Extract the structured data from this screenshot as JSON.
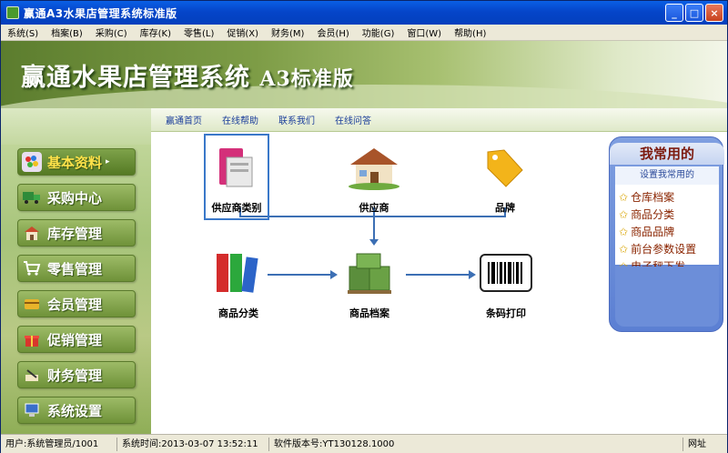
{
  "window": {
    "title": "赢通A3水果店管理系统标准版",
    "btn_min": "_",
    "btn_max": "□",
    "btn_close": "×"
  },
  "menu": [
    "系统(S)",
    "档案(B)",
    "采购(C)",
    "库存(K)",
    "零售(L)",
    "促销(X)",
    "财务(M)",
    "会员(H)",
    "功能(G)",
    "窗口(W)",
    "帮助(H)"
  ],
  "banner": {
    "title": "赢通水果店管理系统",
    "edition": "A3标准版"
  },
  "links": [
    "赢通首页",
    "在线帮助",
    "联系我们",
    "在线问答"
  ],
  "sidebar": [
    {
      "label": "基本资料",
      "icon": "palette-icon",
      "active": true
    },
    {
      "label": "采购中心",
      "icon": "truck-icon",
      "active": false
    },
    {
      "label": "库存管理",
      "icon": "warehouse-icon",
      "active": false
    },
    {
      "label": "零售管理",
      "icon": "cart-icon",
      "active": false
    },
    {
      "label": "会员管理",
      "icon": "member-card-icon",
      "active": false
    },
    {
      "label": "促销管理",
      "icon": "gift-icon",
      "active": false
    },
    {
      "label": "财务管理",
      "icon": "finance-icon",
      "active": false
    },
    {
      "label": "系统设置",
      "icon": "computer-icon",
      "active": false
    }
  ],
  "flow": {
    "supplier_category": "供应商类别",
    "supplier": "供应商",
    "brand": "品牌",
    "product_category": "商品分类",
    "product_archive": "商品档案",
    "barcode_print": "条码打印"
  },
  "favorites": {
    "title": "我常用的",
    "setting": "设置我常用的",
    "items": [
      "仓库档案",
      "商品分类",
      "商品品牌",
      "前台参数设置",
      "电子秤下发"
    ]
  },
  "status": {
    "user": "用户:系统管理员/1001",
    "time": "系统时间:2013-03-07 13:52:11",
    "version": "软件版本号:YT130128.1000",
    "network": "网址"
  },
  "colors": {
    "accent_green": "#6f9239",
    "link_blue": "#1a3d9a",
    "panel_blue": "#5b7fd3"
  }
}
